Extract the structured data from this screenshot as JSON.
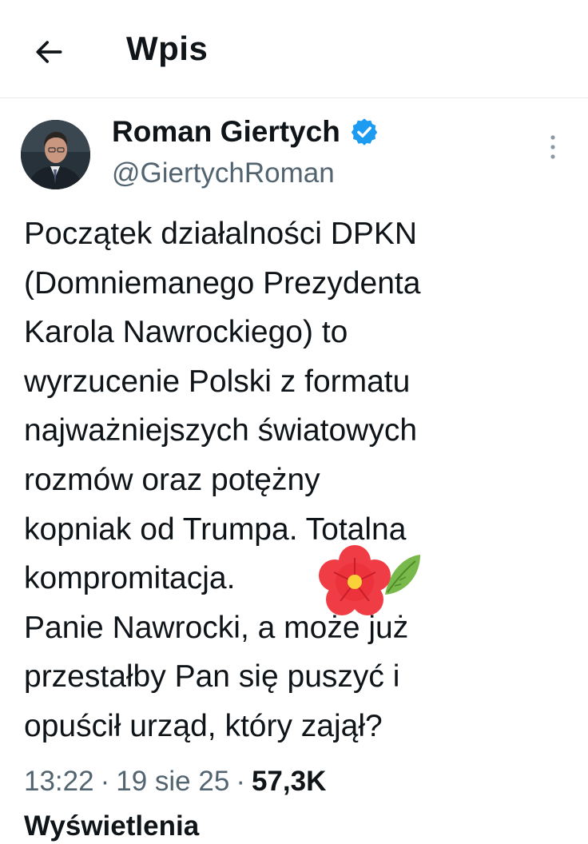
{
  "header": {
    "back_icon": "arrow-left-icon",
    "title": "Wpis"
  },
  "tweet": {
    "author": {
      "name": "Roman Giertych",
      "handle": "@GiertychRoman",
      "verified_icon": "verified-badge-icon",
      "verified_color": "#1d9bf0"
    },
    "more_icon": "more-vertical-icon",
    "text_lines": [
      "Początek działalności DPKN",
      "(Domniemanego Prezydenta",
      "Karola Nawrockiego) to",
      "wyrzucenie Polski z formatu",
      "najważniejszych światowych",
      "rozmów oraz potężny",
      "kopniak od Trumpa. Totalna",
      "kompromitacja.",
      "Panie Nawrocki, a może już",
      "przestałby Pan się puszyć i",
      "opuścił urząd, który zajął?"
    ],
    "emoji": "flower-emoji",
    "meta": {
      "time": "13:22",
      "separator": "·",
      "date": "19 sie 25",
      "views_count": "57,3K",
      "views_label": "Wyświetlenia"
    }
  },
  "colors": {
    "text": "#0f1419",
    "secondary": "#536471",
    "accent": "#1d9bf0",
    "divider": "#e6e9ec"
  }
}
